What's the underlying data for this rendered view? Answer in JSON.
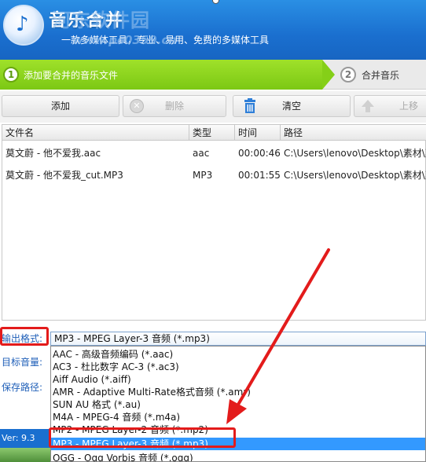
{
  "header": {
    "title": "音乐合并",
    "subtitle": "一款多媒体工具，专业、易用、免费的多媒体工具",
    "watermark": "河东软件园",
    "watermark_url": "www.pc0359.cn"
  },
  "steps": [
    {
      "num": "1",
      "label": "添加要合并的音乐文件"
    },
    {
      "num": "2",
      "label": "合并音乐"
    }
  ],
  "toolbar": {
    "add_label": "添加",
    "delete_label": "删除",
    "clear_label": "清空",
    "up_label": "上移"
  },
  "table": {
    "headers": [
      "文件名",
      "类型",
      "时间",
      "路径"
    ],
    "rows": [
      {
        "name": "莫文蔚 - 他不爱我.aac",
        "type": "aac",
        "time": "00:00:46",
        "path": "C:\\Users\\lenovo\\Desktop\\素材\\莫"
      },
      {
        "name": "莫文蔚 - 他不爱我_cut.MP3",
        "type": "MP3",
        "time": "00:01:55",
        "path": "C:\\Users\\lenovo\\Desktop\\素材\\莫"
      }
    ]
  },
  "settings": {
    "output_format_label": "输出格式:",
    "target_volume_label": "目标音量:",
    "save_path_label": "保存路径:",
    "selected_format": "MP3 - MPEG Layer-3 音频 (*.mp3)",
    "options": [
      "AAC - 高级音频编码 (*.aac)",
      "AC3 - 杜比数字 AC-3 (*.ac3)",
      "Aiff Audio (*.aiff)",
      "AMR - Adaptive Multi-Rate格式音频 (*.amr)",
      "SUN AU 格式 (*.au)",
      "M4A - MPEG-4 音频 (*.m4a)",
      "MP2 - MPEG Layer-2 音频 (*.mp2)",
      "MP3 - MPEG Layer-3 音频 (*.mp3)",
      "OGG - Ogg Vorbis 音频 (*.ogg)"
    ],
    "highlighted_index": 7
  },
  "version": "Ver: 9.3",
  "colors": {
    "header_blue": "#1a6fcf",
    "step_green": "#7cc814",
    "selection_blue": "#3399ff",
    "annotation_red": "#e31b1b"
  }
}
